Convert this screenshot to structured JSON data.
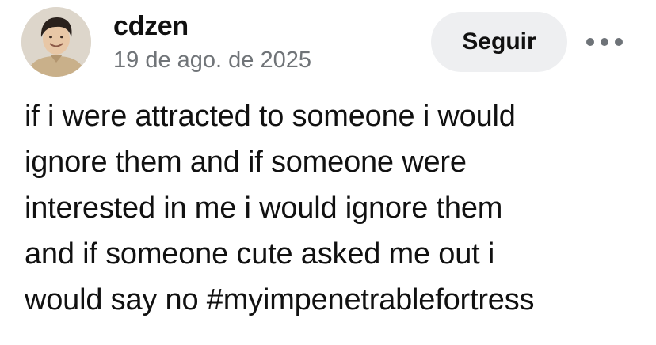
{
  "post": {
    "author": "cdzen",
    "date": "19 de ago. de 2025",
    "follow_label": "Seguir",
    "more_icon": "more-horizontal-icon",
    "text_lines": [
      "if i were attracted to someone i would",
      "ignore them and if someone were",
      "interested in me i would ignore them",
      "and if someone cute asked me out i",
      "would say no #myimpenetrablefortress"
    ]
  },
  "colors": {
    "background": "#ffffff",
    "text": "#111111",
    "muted": "#707478",
    "button_bg": "#eeeff1"
  }
}
